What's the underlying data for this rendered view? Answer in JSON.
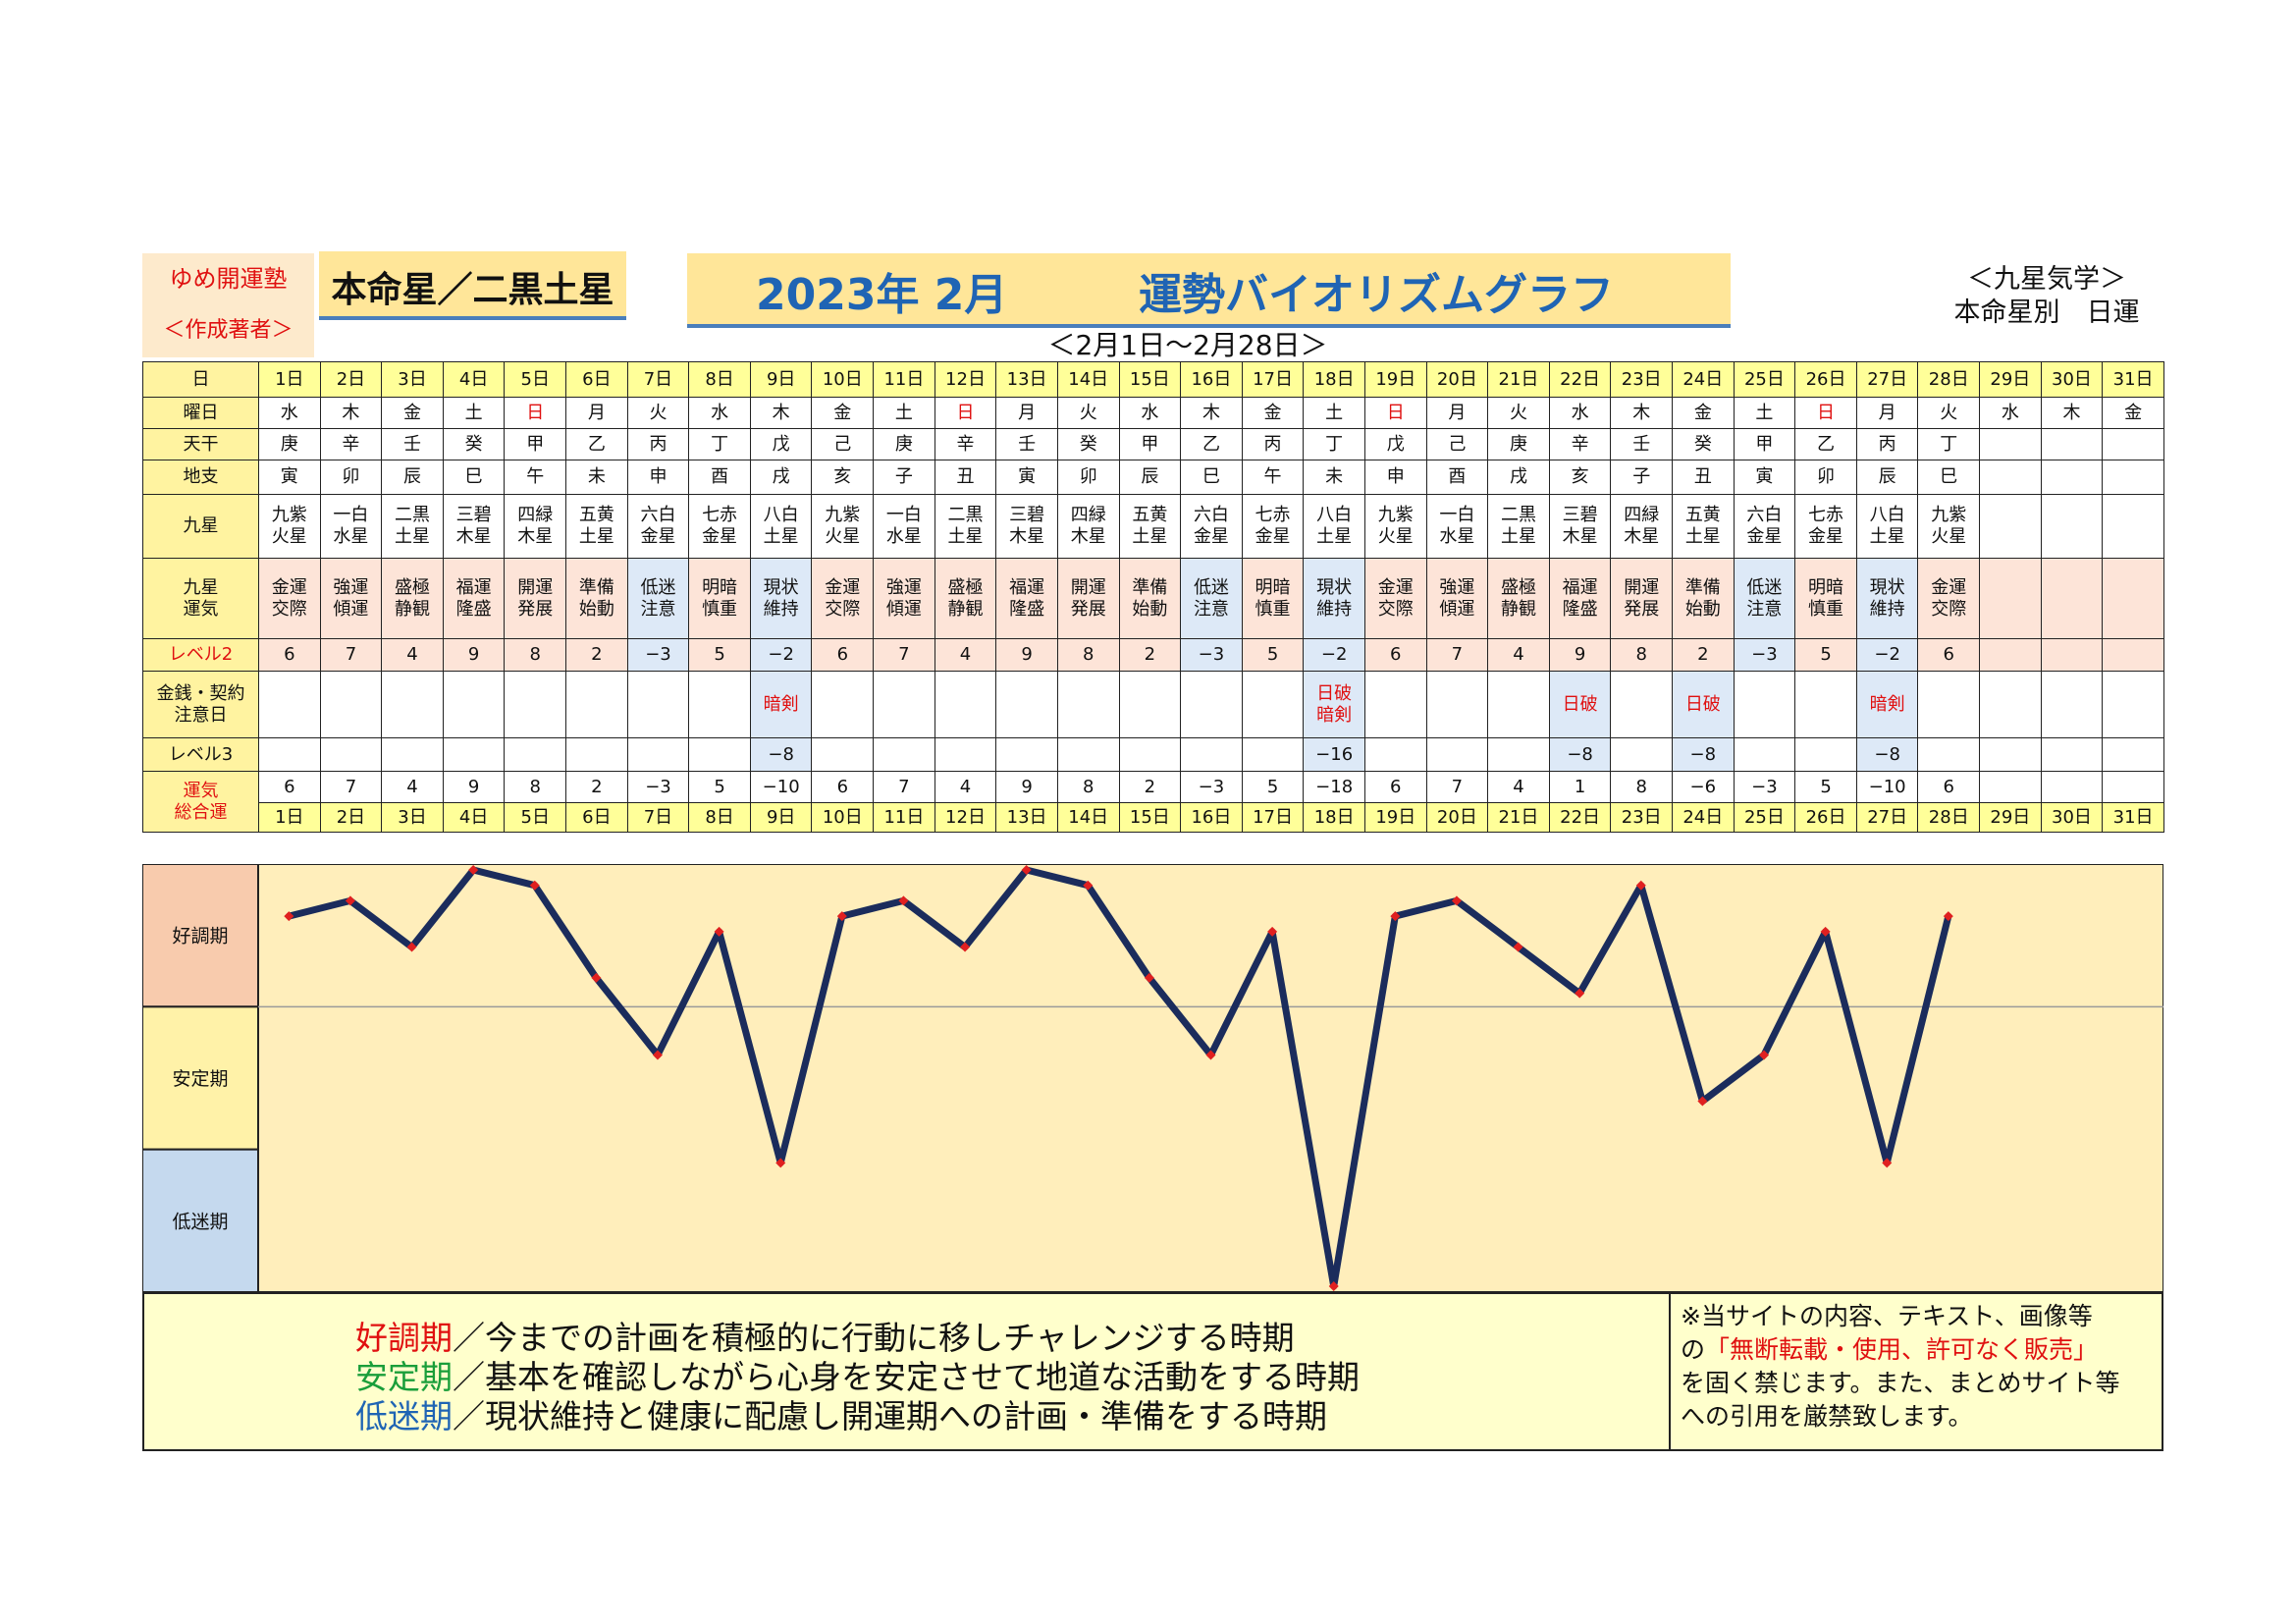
{
  "header": {
    "org_name": "ゆめ開運塾",
    "org_sub": "＜作成著者＞",
    "star_title": "本命星／二黒土星",
    "title_month": "2023年 2月",
    "title_main": "運勢バイオリズムグラフ",
    "range_label": "＜2月1日～2月28日＞",
    "kyusei_line1": "＜九星気学＞",
    "kyusei_line2": "本命星別　日運"
  },
  "row_labels": {
    "day": "日",
    "weekday": "曜日",
    "tenkan": "天干",
    "chishi": "地支",
    "kyusei": "九星",
    "kyusei_unki": "九星\n運気",
    "level2": "レベル2",
    "caution": "金銭・契約\n注意日",
    "level3": "レベル3",
    "total": "運気\n総合運"
  },
  "days": [
    "1日",
    "2日",
    "3日",
    "4日",
    "5日",
    "6日",
    "7日",
    "8日",
    "9日",
    "10日",
    "11日",
    "12日",
    "13日",
    "14日",
    "15日",
    "16日",
    "17日",
    "18日",
    "19日",
    "20日",
    "21日",
    "22日",
    "23日",
    "24日",
    "25日",
    "26日",
    "27日",
    "28日",
    "29日",
    "30日",
    "31日"
  ],
  "weekdays": [
    "水",
    "木",
    "金",
    "土",
    "日",
    "月",
    "火",
    "水",
    "木",
    "金",
    "土",
    "日",
    "月",
    "火",
    "水",
    "木",
    "金",
    "土",
    "日",
    "月",
    "火",
    "水",
    "木",
    "金",
    "土",
    "日",
    "月",
    "火",
    "水",
    "木",
    "金"
  ],
  "tenkan": [
    "庚",
    "辛",
    "壬",
    "癸",
    "甲",
    "乙",
    "丙",
    "丁",
    "戊",
    "己",
    "庚",
    "辛",
    "壬",
    "癸",
    "甲",
    "乙",
    "丙",
    "丁",
    "戊",
    "己",
    "庚",
    "辛",
    "壬",
    "癸",
    "甲",
    "乙",
    "丙",
    "丁",
    "",
    "",
    ""
  ],
  "chishi": [
    "寅",
    "卯",
    "辰",
    "巳",
    "午",
    "未",
    "申",
    "酉",
    "戌",
    "亥",
    "子",
    "丑",
    "寅",
    "卯",
    "辰",
    "巳",
    "午",
    "未",
    "申",
    "酉",
    "戌",
    "亥",
    "子",
    "丑",
    "寅",
    "卯",
    "辰",
    "巳",
    "",
    "",
    ""
  ],
  "kyusei": [
    "九紫\n火星",
    "一白\n水星",
    "二黒\n土星",
    "三碧\n木星",
    "四緑\n木星",
    "五黄\n土星",
    "六白\n金星",
    "七赤\n金星",
    "八白\n土星",
    "九紫\n火星",
    "一白\n水星",
    "二黒\n土星",
    "三碧\n木星",
    "四緑\n木星",
    "五黄\n土星",
    "六白\n金星",
    "七赤\n金星",
    "八白\n土星",
    "九紫\n火星",
    "一白\n水星",
    "二黒\n土星",
    "三碧\n木星",
    "四緑\n木星",
    "五黄\n土星",
    "六白\n金星",
    "七赤\n金星",
    "八白\n土星",
    "九紫\n火星",
    "",
    "",
    ""
  ],
  "unki": [
    "金運\n交際",
    "強運\n傾運",
    "盛極\n静観",
    "福運\n隆盛",
    "開運\n発展",
    "準備\n始動",
    "低迷\n注意",
    "明暗\n慎重",
    "現状\n維持",
    "金運\n交際",
    "強運\n傾運",
    "盛極\n静観",
    "福運\n隆盛",
    "開運\n発展",
    "準備\n始動",
    "低迷\n注意",
    "明暗\n慎重",
    "現状\n維持",
    "金運\n交際",
    "強運\n傾運",
    "盛極\n静観",
    "福運\n隆盛",
    "開運\n発展",
    "準備\n始動",
    "低迷\n注意",
    "明暗\n慎重",
    "現状\n維持",
    "金運\n交際",
    "",
    "",
    ""
  ],
  "level2": [
    "6",
    "7",
    "4",
    "9",
    "8",
    "2",
    "−3",
    "5",
    "−2",
    "6",
    "7",
    "4",
    "9",
    "8",
    "2",
    "−3",
    "5",
    "−2",
    "6",
    "7",
    "4",
    "9",
    "8",
    "2",
    "−3",
    "5",
    "−2",
    "6",
    "",
    "",
    ""
  ],
  "caution": [
    "",
    "",
    "",
    "",
    "",
    "",
    "",
    "",
    "暗剣",
    "",
    "",
    "",
    "",
    "",
    "",
    "",
    "",
    "日破\n暗剣",
    "",
    "",
    "",
    "日破",
    "",
    "日破",
    "",
    "",
    "暗剣",
    "",
    "",
    "",
    ""
  ],
  "level3": [
    "",
    "",
    "",
    "",
    "",
    "",
    "",
    "",
    "−8",
    "",
    "",
    "",
    "",
    "",
    "",
    "",
    "",
    "−16",
    "",
    "",
    "",
    "−8",
    "",
    "−8",
    "",
    "",
    "−8",
    "",
    "",
    "",
    ""
  ],
  "total": [
    "6",
    "7",
    "4",
    "9",
    "8",
    "2",
    "−3",
    "5",
    "−10",
    "6",
    "7",
    "4",
    "9",
    "8",
    "2",
    "−3",
    "5",
    "−18",
    "6",
    "7",
    "4",
    "1",
    "8",
    "−6",
    "−3",
    "5",
    "−10",
    "6",
    "",
    "",
    ""
  ],
  "bands": {
    "good": "好調期",
    "stable": "安定期",
    "low": "低迷期"
  },
  "legend": {
    "good_term": "好調期",
    "good_text": "／今までの計画を積極的に行動に移しチャレンジする時期",
    "stable_term": "安定期",
    "stable_text": "／基本を確認しながら心身を安定させて地道な活動をする時期",
    "low_term": "低迷期",
    "low_text": "／現状維持と健康に配慮し開運期への計画・準備をする時期"
  },
  "notice": {
    "line1": "※当サイトの内容、テキスト、画像等",
    "line2_a": "の",
    "line2_b": "「無断転載・使用、許可なく販売」",
    "line3": "を固く禁じます。また、まとめサイト等",
    "line4": "への引用を厳禁致します。"
  },
  "chart_data": {
    "type": "line",
    "x": [
      "1日",
      "2日",
      "3日",
      "4日",
      "5日",
      "6日",
      "7日",
      "8日",
      "9日",
      "10日",
      "11日",
      "12日",
      "13日",
      "14日",
      "15日",
      "16日",
      "17日",
      "18日",
      "19日",
      "20日",
      "21日",
      "22日",
      "23日",
      "24日",
      "25日",
      "26日",
      "27日",
      "28日"
    ],
    "series": [
      {
        "values": [
          6,
          7,
          4,
          9,
          8,
          2,
          -3,
          5,
          -10,
          6,
          7,
          4,
          9,
          8,
          2,
          -3,
          5,
          -18,
          6,
          7,
          4,
          1,
          8,
          -6,
          -3,
          5,
          -10,
          6
        ]
      }
    ],
    "ylim": [
      -18,
      9
    ],
    "line_color": "#1b2c5c",
    "marker_color": "#e02020",
    "band_colors": {
      "good": "#f8cbad",
      "stable": "#fff2a8",
      "low": "#c5d9ee",
      "plot_bg": "#ffeebb"
    }
  }
}
